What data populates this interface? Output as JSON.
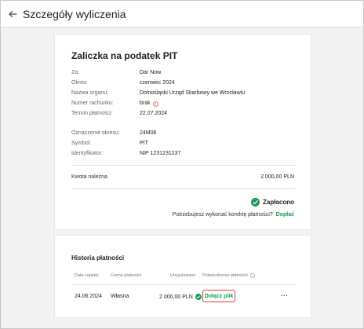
{
  "header": {
    "title": "Szczegóły wyliczenia"
  },
  "details": {
    "title": "Zaliczka na podatek PIT",
    "rows": [
      {
        "label": "Za:",
        "value": "Dar Now"
      },
      {
        "label": "Okres:",
        "value": "czerwiec 2024"
      },
      {
        "label": "Nazwa organu:",
        "value": "Dolnośląski Urząd Skarbowy we Wrocławiu"
      },
      {
        "label": "Numer rachunku:",
        "value": "brak"
      },
      {
        "label": "Termin płatności:",
        "value": "22.07.2024"
      },
      {
        "label": "Oznaczenie okresu:",
        "value": "24M06"
      },
      {
        "label": "Symbol:",
        "value": "PIT"
      },
      {
        "label": "Identyfikator:",
        "value": "NIP 1231231237"
      }
    ],
    "amount_label": "Kwota należna",
    "amount_value": "2 000,00 PLN",
    "status": "Zapłacono",
    "correction_question": "Potrzebujesz wykonać korektę płatności?",
    "correction_link": "Dopłać",
    "colors": {
      "accent": "#1a9a55",
      "warning": "#e03a3a"
    }
  },
  "history": {
    "title": "Historia płatności",
    "columns": [
      "Data zapłaty",
      "Forma płatności",
      "Uregulowano",
      "Potwierdzenie płatności"
    ],
    "rows": [
      {
        "date": "24.06.2024",
        "form": "Własna",
        "amount": "2 000,00 PLN",
        "attach_label": "Dołącz plik",
        "more": "···"
      }
    ]
  }
}
